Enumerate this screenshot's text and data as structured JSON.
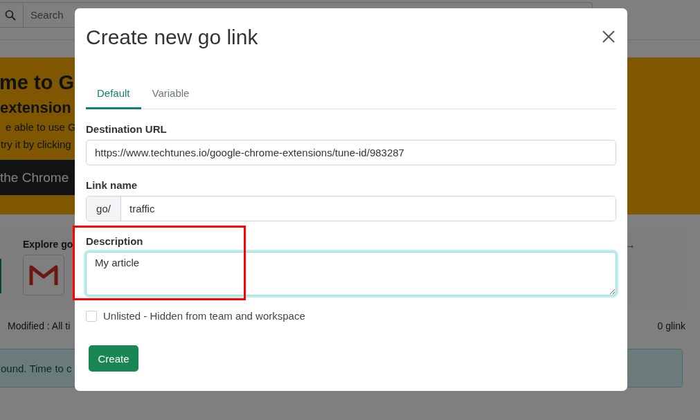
{
  "background_page": {
    "search": {
      "placeholder": "Search"
    },
    "banner": {
      "title": "me to G",
      "subtitle": "extension",
      "lines": [
        "e able to use G",
        "try it by clicking"
      ],
      "button": "the Chrome"
    },
    "explore": {
      "title": "Explore go",
      "arrow": "→"
    },
    "filter": "Modified : All ti",
    "count": "0 glink",
    "alert": "ound. Time to c"
  },
  "dialog": {
    "title": "Create new go link",
    "tabs": [
      {
        "label": "Default",
        "selected": true
      },
      {
        "label": "Variable",
        "selected": false
      }
    ],
    "destination": {
      "label": "Destination URL",
      "value": "https://www.techtunes.io/google-chrome-extensions/tune-id/983287"
    },
    "link_name": {
      "label": "Link name",
      "prefix": "go/",
      "value": "traffic"
    },
    "description": {
      "label": "Description",
      "value": "My article",
      "focused": true
    },
    "unlisted": {
      "label": "Unlisted - Hidden from team and workspace",
      "checked": false
    },
    "button": "Create"
  }
}
